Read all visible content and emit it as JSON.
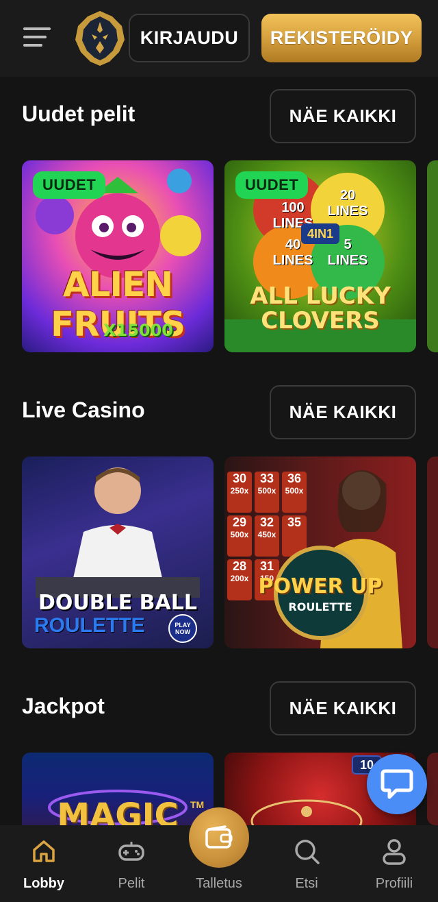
{
  "header": {
    "menu_icon": "hamburger-menu-icon",
    "logo_icon": "lion-logo-icon",
    "login_label": "KIRJAUDU",
    "register_label": "REKISTERÖIDY"
  },
  "sections": {
    "new_games": {
      "title": "Uudet pelit",
      "see_all": "NÄE KAIKKI",
      "tiles": [
        {
          "name": "ALIEN FRUITS",
          "sub": "X15000",
          "badge": "UUDET"
        },
        {
          "name": "ALL LUCKY CLOVERS",
          "sub": "4IN1",
          "badge": "UUDET",
          "lines": [
            "100 LINES",
            "20 LINES",
            "40 LINES",
            "5 LINES"
          ]
        }
      ]
    },
    "live_casino": {
      "title": "Live Casino",
      "see_all": "NÄE KAIKKI",
      "tiles": [
        {
          "line1": "DOUBLE BALL",
          "line2": "ROULETTE",
          "play_now": "PLAY NOW"
        },
        {
          "line1": "POWER UP",
          "line2": "ROULETTE",
          "grid": [
            "30",
            "33",
            "36",
            "29",
            "32",
            "35",
            "28",
            "31"
          ],
          "mults": [
            "250x",
            "500x",
            "500x",
            "500x",
            "450x",
            "",
            "200x",
            "150"
          ]
        }
      ]
    },
    "jackpot": {
      "title": "Jackpot",
      "see_all": "NÄE KAIKKI",
      "tiles": [
        {
          "name": "MAGIC",
          "tm": "TM"
        },
        {
          "tag": "10"
        }
      ]
    }
  },
  "chat_icon": "chat-bubble-icon",
  "bottom_nav": {
    "items": [
      {
        "label": "Lobby",
        "icon": "home-icon",
        "active": true
      },
      {
        "label": "Pelit",
        "icon": "gamepad-icon"
      },
      {
        "label": "Talletus",
        "icon": "wallet-icon"
      },
      {
        "label": "Etsi",
        "icon": "search-icon"
      },
      {
        "label": "Profiili",
        "icon": "user-icon"
      }
    ]
  },
  "colors": {
    "background": "#141414",
    "header": "#1b1b1b",
    "gold": "#d9a441",
    "badge_green": "#22d453",
    "chat_blue": "#4a8df6"
  }
}
